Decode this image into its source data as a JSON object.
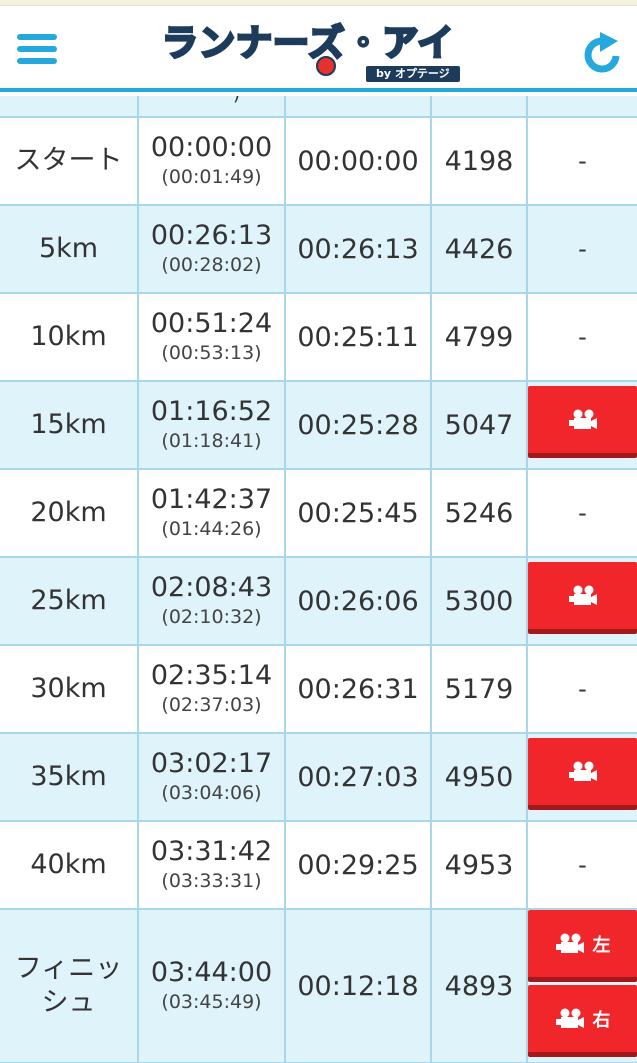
{
  "header": {
    "logo_text": "ランナーズ・アイ",
    "logo_sub": "by オプテージ"
  },
  "rows": [
    {
      "point": "スタート",
      "time": "00:00:00",
      "sub": "(00:01:49)",
      "lap": "00:00:00",
      "rank": "4198",
      "video": "-"
    },
    {
      "point": "5km",
      "time": "00:26:13",
      "sub": "(00:28:02)",
      "lap": "00:26:13",
      "rank": "4426",
      "video": "-"
    },
    {
      "point": "10km",
      "time": "00:51:24",
      "sub": "(00:53:13)",
      "lap": "00:25:11",
      "rank": "4799",
      "video": "-"
    },
    {
      "point": "15km",
      "time": "01:16:52",
      "sub": "(01:18:41)",
      "lap": "00:25:28",
      "rank": "5047",
      "video": "video-camera-icon"
    },
    {
      "point": "20km",
      "time": "01:42:37",
      "sub": "(01:44:26)",
      "lap": "00:25:45",
      "rank": "5246",
      "video": "-"
    },
    {
      "point": "25km",
      "time": "02:08:43",
      "sub": "(02:10:32)",
      "lap": "00:26:06",
      "rank": "5300",
      "video": "video-camera-icon"
    },
    {
      "point": "30km",
      "time": "02:35:14",
      "sub": "(02:37:03)",
      "lap": "00:26:31",
      "rank": "5179",
      "video": "-"
    },
    {
      "point": "35km",
      "time": "03:02:17",
      "sub": "(03:04:06)",
      "lap": "00:27:03",
      "rank": "4950",
      "video": "video-camera-icon"
    },
    {
      "point": "40km",
      "time": "03:31:42",
      "sub": "(03:33:31)",
      "lap": "00:29:25",
      "rank": "4953",
      "video": "-"
    },
    {
      "point_line1": "フィニッ",
      "point_line2": "シュ",
      "time": "03:44:00",
      "sub": "(03:45:49)",
      "lap": "00:12:18",
      "rank": "4893",
      "video_left": "左",
      "video_right": "右"
    }
  ],
  "colors": {
    "accent_blue": "#25a9dc",
    "row_alt": "#dff3fb",
    "grid_line": "#a8d7ec",
    "video_red": "#f0262a"
  }
}
